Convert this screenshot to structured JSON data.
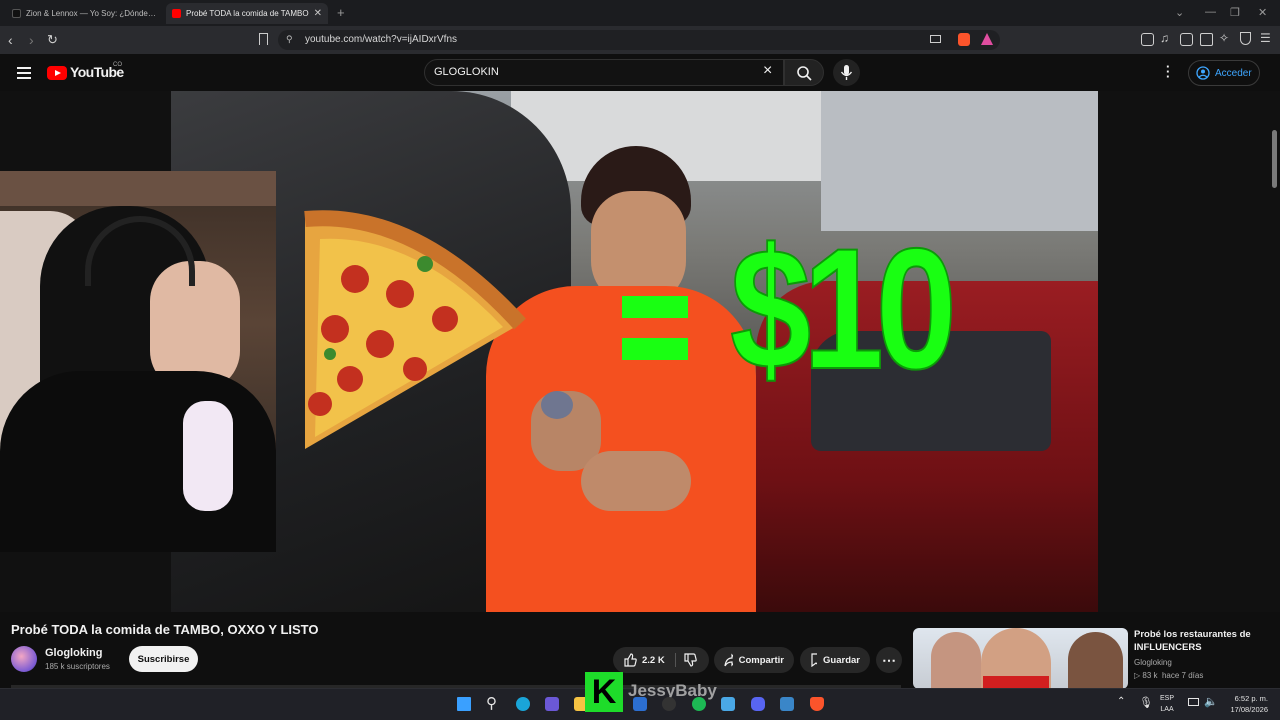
{
  "browser": {
    "tabs": [
      {
        "title": "Zion & Lennox — Yo Soy: ¿Dónde va",
        "active": false
      },
      {
        "title": "Probé TODA la comida de TAMBO",
        "active": true
      }
    ],
    "new_tab": "+",
    "url": "youtube.com/watch?v=ijAIDxrVfns"
  },
  "youtube": {
    "logo_text": "YouTube",
    "region": "CO",
    "search_value": "GLOGLOKIN",
    "clear_icon": "×",
    "signin_label": "Acceder"
  },
  "video": {
    "overlay_price": "$10",
    "title": "Probé TODA la comida de TAMBO, OXXO Y LISTO",
    "channel": {
      "name": "Glogloking",
      "subscribers": "185 k suscriptores"
    },
    "subscribe_label": "Suscribirse",
    "likes": "2.2 K",
    "share_label": "Compartir",
    "save_label": "Guardar"
  },
  "recommendation": {
    "title": "Probé los restaurantes de INFLUENCERS",
    "channel": "Glogloking",
    "views": "83 k",
    "age": "hace 7 días"
  },
  "stream_overlay": {
    "badge_letter": "K",
    "streamer_name": "JessyBaby"
  },
  "taskbar": {
    "language_line1": "ESP",
    "language_line2": "LAA",
    "time": "6:52 p. m.",
    "date": "17/08/2026"
  },
  "colors": {
    "youtube_red": "#ff0000",
    "link_blue": "#3ea6ff",
    "price_green": "#19ff12",
    "kick_green": "#1edc2a"
  }
}
